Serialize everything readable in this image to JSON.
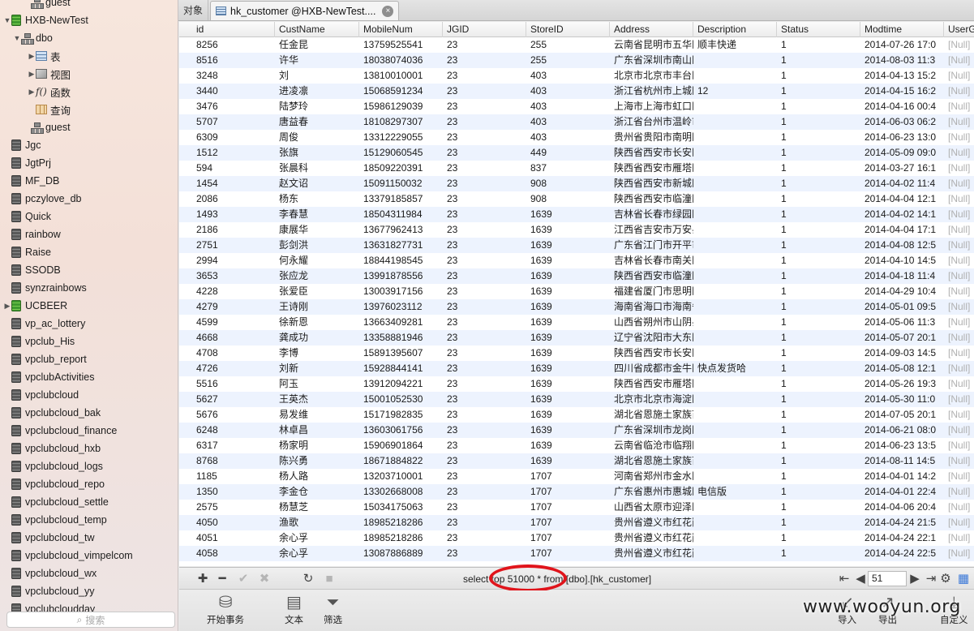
{
  "sidebar": {
    "items": [
      {
        "label": "guest",
        "type": "schema",
        "indent": 2,
        "disclosure": ""
      },
      {
        "label": "HXB-NewTest",
        "type": "db-green",
        "indent": 0,
        "disclosure": "▼"
      },
      {
        "label": "dbo",
        "type": "schema",
        "indent": 1,
        "disclosure": "▼"
      },
      {
        "label": "表",
        "type": "tables",
        "indent": 3,
        "disclosure": "▶"
      },
      {
        "label": "视图",
        "type": "views",
        "indent": 3,
        "disclosure": "▶"
      },
      {
        "label": "函数",
        "type": "functions",
        "indent": 3,
        "disclosure": "▶"
      },
      {
        "label": "查询",
        "type": "queries",
        "indent": 3,
        "disclosure": ""
      },
      {
        "label": "guest",
        "type": "schema",
        "indent": 2,
        "disclosure": ""
      },
      {
        "label": "Jgc",
        "type": "db",
        "indent": 0,
        "disclosure": ""
      },
      {
        "label": "JgtPrj",
        "type": "db",
        "indent": 0,
        "disclosure": ""
      },
      {
        "label": "MF_DB",
        "type": "db",
        "indent": 0,
        "disclosure": ""
      },
      {
        "label": "pczylove_db",
        "type": "db",
        "indent": 0,
        "disclosure": ""
      },
      {
        "label": "Quick",
        "type": "db",
        "indent": 0,
        "disclosure": ""
      },
      {
        "label": "rainbow",
        "type": "db",
        "indent": 0,
        "disclosure": ""
      },
      {
        "label": "Raise",
        "type": "db",
        "indent": 0,
        "disclosure": ""
      },
      {
        "label": "SSODB",
        "type": "db",
        "indent": 0,
        "disclosure": ""
      },
      {
        "label": "synzrainbows",
        "type": "db",
        "indent": 0,
        "disclosure": ""
      },
      {
        "label": "UCBEER",
        "type": "db-green",
        "indent": 0,
        "disclosure": "▶"
      },
      {
        "label": "vp_ac_lottery",
        "type": "db",
        "indent": 0,
        "disclosure": ""
      },
      {
        "label": "vpclub_His",
        "type": "db",
        "indent": 0,
        "disclosure": ""
      },
      {
        "label": "vpclub_report",
        "type": "db",
        "indent": 0,
        "disclosure": ""
      },
      {
        "label": "vpclubActivities",
        "type": "db",
        "indent": 0,
        "disclosure": ""
      },
      {
        "label": "vpclubcloud",
        "type": "db",
        "indent": 0,
        "disclosure": ""
      },
      {
        "label": "vpclubcloud_bak",
        "type": "db",
        "indent": 0,
        "disclosure": ""
      },
      {
        "label": "vpclubcloud_finance",
        "type": "db",
        "indent": 0,
        "disclosure": ""
      },
      {
        "label": "vpclubcloud_hxb",
        "type": "db",
        "indent": 0,
        "disclosure": ""
      },
      {
        "label": "vpclubcloud_logs",
        "type": "db",
        "indent": 0,
        "disclosure": ""
      },
      {
        "label": "vpclubcloud_repo",
        "type": "db",
        "indent": 0,
        "disclosure": ""
      },
      {
        "label": "vpclubcloud_settle",
        "type": "db",
        "indent": 0,
        "disclosure": ""
      },
      {
        "label": "vpclubcloud_temp",
        "type": "db",
        "indent": 0,
        "disclosure": ""
      },
      {
        "label": "vpclubcloud_tw",
        "type": "db",
        "indent": 0,
        "disclosure": ""
      },
      {
        "label": "vpclubcloud_vimpelcom",
        "type": "db",
        "indent": 0,
        "disclosure": ""
      },
      {
        "label": "vpclubcloud_wx",
        "type": "db",
        "indent": 0,
        "disclosure": ""
      },
      {
        "label": "vpclubcloud_yy",
        "type": "db",
        "indent": 0,
        "disclosure": ""
      },
      {
        "label": "vpclubcloudday",
        "type": "db",
        "indent": 0,
        "disclosure": ""
      }
    ],
    "search_placeholder": "搜索"
  },
  "tabs": {
    "objects_label": "对象",
    "active_label": "hk_customer @HXB-NewTest....",
    "close_glyph": "×"
  },
  "grid": {
    "columns": [
      "id",
      "CustName",
      "MobileNum",
      "JGID",
      "StoreID",
      "Address",
      "Description",
      "Status",
      "Modtime",
      "UserG"
    ],
    "rows": [
      [
        "8256",
        "任金昆",
        "13759525541",
        "23",
        "255",
        "云南省昆明市五华区",
        "顺丰快递",
        "1",
        "2014-07-26 17:0",
        "[Null]"
      ],
      [
        "8516",
        "许华",
        "18038074036",
        "23",
        "255",
        "广东省深圳市南山区",
        "",
        "1",
        "2014-08-03 11:3",
        "[Null]"
      ],
      [
        "3248",
        "刘",
        "13810010001",
        "23",
        "403",
        "北京市北京市丰台区",
        "",
        "1",
        "2014-04-13 15:2",
        "[Null]"
      ],
      [
        "3440",
        "进凌凛",
        "15068591234",
        "23",
        "403",
        "浙江省杭州市上城区",
        "12",
        "1",
        "2014-04-15 16:2",
        "[Null]"
      ],
      [
        "3476",
        "陆梦玲",
        "15986129039",
        "23",
        "403",
        "上海市上海市虹口区",
        "",
        "1",
        "2014-04-16 00:4",
        "[Null]"
      ],
      [
        "5707",
        "唐益春",
        "18108297307",
        "23",
        "403",
        "浙江省台州市温岭市",
        "",
        "1",
        "2014-06-03 06:2",
        "[Null]"
      ],
      [
        "6309",
        "周俊",
        "13312229055",
        "23",
        "403",
        "贵州省贵阳市南明区",
        "",
        "1",
        "2014-06-23 13:0",
        "[Null]"
      ],
      [
        "1512",
        "张旗",
        "15129060545",
        "23",
        "449",
        "陕西省西安市长安区",
        "",
        "1",
        "2014-05-09 09:0",
        "[Null]"
      ],
      [
        "594",
        "张晨科",
        "18509220391",
        "23",
        "837",
        "陕西省西安市雁塔区",
        "",
        "1",
        "2014-03-27 16:1",
        "[Null]"
      ],
      [
        "1454",
        "赵文诏",
        "15091150032",
        "23",
        "908",
        "陕西省西安市新城区",
        "",
        "1",
        "2014-04-02 11:4",
        "[Null]"
      ],
      [
        "2086",
        "杨东",
        "13379185857",
        "23",
        "908",
        "陕西省西安市临潼区",
        "",
        "1",
        "2014-04-04 12:1",
        "[Null]"
      ],
      [
        "1493",
        "李春慧",
        "18504311984",
        "23",
        "1639",
        "吉林省长春市绿园区",
        "",
        "1",
        "2014-04-02 14:1",
        "[Null]"
      ],
      [
        "2186",
        "康展华",
        "13677962413",
        "23",
        "1639",
        "江西省吉安市万安县",
        "",
        "1",
        "2014-04-04 17:1",
        "[Null]"
      ],
      [
        "2751",
        "彭剑洪",
        "13631827731",
        "23",
        "1639",
        "广东省江门市开平市",
        "",
        "1",
        "2014-04-08 12:5",
        "[Null]"
      ],
      [
        "2994",
        "何永耀",
        "18844198545",
        "23",
        "1639",
        "吉林省长春市南关区",
        "",
        "1",
        "2014-04-10 14:5",
        "[Null]"
      ],
      [
        "3653",
        "张应龙",
        "13991878556",
        "23",
        "1639",
        "陕西省西安市临潼区",
        "",
        "1",
        "2014-04-18 11:4",
        "[Null]"
      ],
      [
        "4228",
        "张爱臣",
        "13003917156",
        "23",
        "1639",
        "福建省厦门市思明区",
        "",
        "1",
        "2014-04-29 10:4",
        "[Null]"
      ],
      [
        "4279",
        "王诗刚",
        "13976023112",
        "23",
        "1639",
        "海南省海口市海南省",
        "",
        "1",
        "2014-05-01 09:5",
        "[Null]"
      ],
      [
        "4599",
        "徐新恩",
        "13663409281",
        "23",
        "1639",
        "山西省朔州市山阴县",
        "",
        "1",
        "2014-05-06 11:3",
        "[Null]"
      ],
      [
        "4668",
        "龚成功",
        "13358881946",
        "23",
        "1639",
        "辽宁省沈阳市大东区",
        "",
        "1",
        "2014-05-07 20:1",
        "[Null]"
      ],
      [
        "4708",
        "李博",
        "15891395607",
        "23",
        "1639",
        "陕西省西安市长安区",
        "",
        "1",
        "2014-09-03 14:5",
        "[Null]"
      ],
      [
        "4726",
        "刘新",
        "15928844141",
        "23",
        "1639",
        "四川省成都市金牛区",
        "快点发货哈",
        "1",
        "2014-05-08 12:1",
        "[Null]"
      ],
      [
        "5516",
        "阿玉",
        "13912094221",
        "23",
        "1639",
        "陕西省西安市雁塔区",
        "",
        "1",
        "2014-05-26 19:3",
        "[Null]"
      ],
      [
        "5627",
        "王英杰",
        "15001052530",
        "23",
        "1639",
        "北京市北京市海淀区",
        "",
        "1",
        "2014-05-30 11:0",
        "[Null]"
      ],
      [
        "5676",
        "易发维",
        "15171982835",
        "23",
        "1639",
        "湖北省恩施土家族苗",
        "",
        "1",
        "2014-07-05 20:1",
        "[Null]"
      ],
      [
        "6248",
        "林卓昌",
        "13603061756",
        "23",
        "1639",
        "广东省深圳市龙岗区",
        "",
        "1",
        "2014-06-21 08:0",
        "[Null]"
      ],
      [
        "6317",
        "杨家明",
        "15906901864",
        "23",
        "1639",
        "云南省临沧市临翔区",
        "",
        "1",
        "2014-06-23 13:5",
        "[Null]"
      ],
      [
        "8768",
        "陈兴勇",
        "18671884822",
        "23",
        "1639",
        "湖北省恩施土家族苗",
        "",
        "1",
        "2014-08-11 14:5",
        "[Null]"
      ],
      [
        "1185",
        "杨人路",
        "13203710001",
        "23",
        "1707",
        "河南省郑州市金水区",
        "",
        "1",
        "2014-04-01 14:2",
        "[Null]"
      ],
      [
        "1350",
        "李金仓",
        "13302668008",
        "23",
        "1707",
        "广东省惠州市惠城区",
        "电信版",
        "1",
        "2014-04-01 22:4",
        "[Null]"
      ],
      [
        "2575",
        "杨慧芝",
        "15034175063",
        "23",
        "1707",
        "山西省太原市迎泽区",
        "",
        "1",
        "2014-04-06 20:4",
        "[Null]"
      ],
      [
        "4050",
        "渔歌",
        "18985218286",
        "23",
        "1707",
        "贵州省遵义市红花岗",
        "",
        "1",
        "2014-04-24 21:5",
        "[Null]"
      ],
      [
        "4051",
        "余心孚",
        "18985218286",
        "23",
        "1707",
        "贵州省遵义市红花岗",
        "",
        "1",
        "2014-04-24 22:1",
        "[Null]"
      ],
      [
        "4058",
        "余心孚",
        "13087886889",
        "23",
        "1707",
        "贵州省遵义市红花岗",
        "",
        "1",
        "2014-04-24 22:5",
        "[Null]"
      ]
    ]
  },
  "bottom_bar": {
    "sql": "select top 51000 * from [dbo].[hk_customer]",
    "page": "51"
  },
  "actions": [
    {
      "label": "开始事务",
      "icon": "database-transaction-icon"
    },
    {
      "label": "文本",
      "icon": "text-document-icon"
    },
    {
      "label": "筛选",
      "icon": "filter-icon"
    },
    {
      "label": "导入",
      "icon": "import-icon"
    },
    {
      "label": "导出",
      "icon": "export-icon"
    },
    {
      "label": "自定义",
      "icon": "customize-icon"
    }
  ],
  "watermark": "www.wooyun.org",
  "colors": {
    "row_alt": "#edf3fe",
    "highlight_ellipse": "#e0141b",
    "null_text": "#b0b0b0"
  }
}
